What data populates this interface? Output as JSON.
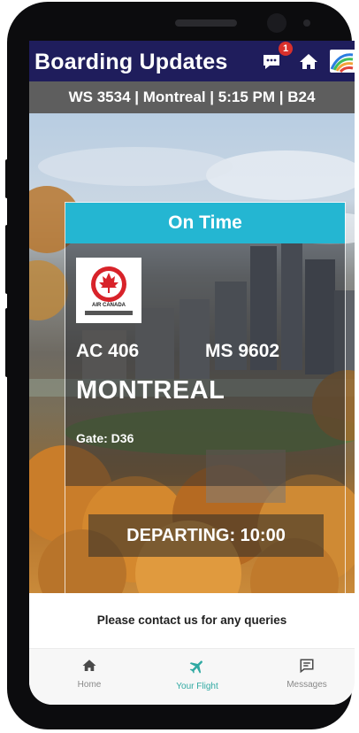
{
  "header": {
    "title": "Boarding Updates",
    "notification_count": "1",
    "icons": [
      "chat-bubble-icon",
      "home-icon",
      "airline-logo-icon"
    ]
  },
  "flight_bar": {
    "text": "WS 3534 | Montreal | 5:15 PM | B24"
  },
  "card": {
    "status": "On Time",
    "airline_logo_text": "AIR CANADA",
    "flight_primary": "AC 406",
    "flight_secondary": "MS 9602",
    "destination": "MONTREAL",
    "gate": "Gate: D36",
    "departing": "DEPARTING: 10:00"
  },
  "contact_text": "Please contact us for any queries",
  "nav": {
    "items": [
      {
        "label": "Home",
        "icon": "home-icon",
        "active": false
      },
      {
        "label": "Your Flight",
        "icon": "airplane-icon",
        "active": true
      },
      {
        "label": "Messages",
        "icon": "message-icon",
        "active": false
      }
    ]
  },
  "colors": {
    "header_bg": "#1f1d5c",
    "flight_bar_bg": "#5e5e5e",
    "status_bg": "#24b6d2",
    "active_nav": "#2fa9a2",
    "badge": "#d9302c"
  }
}
